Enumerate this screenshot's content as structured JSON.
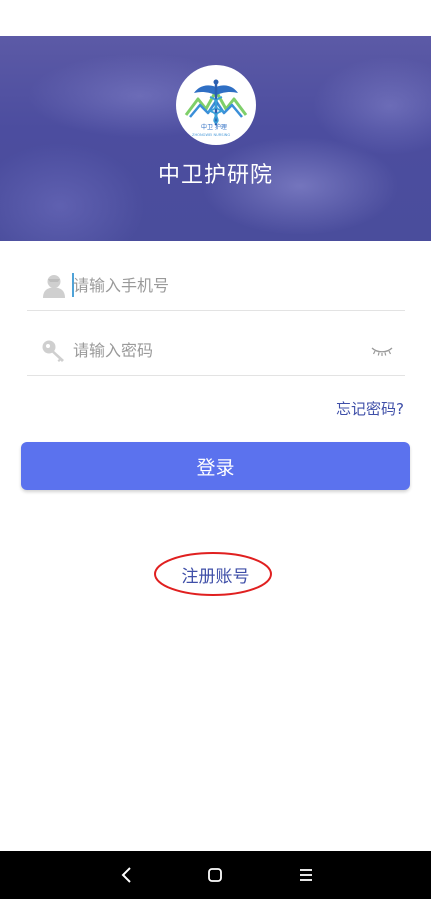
{
  "app": {
    "title": "中卫护研院",
    "logo_text_cn": "中卫 护理",
    "logo_text_en": "ZHONGWEI NURSING"
  },
  "login": {
    "phone_placeholder": "请输入手机号",
    "password_placeholder": "请输入密码",
    "forgot_label": "忘记密码?",
    "login_label": "登录",
    "register_label": "注册账号"
  },
  "icons": {
    "phone_field": "user-icon",
    "password_field": "key-icon",
    "password_toggle": "eye-closed-icon",
    "nav": [
      "back-icon",
      "home-icon",
      "menu-icon"
    ]
  },
  "colors": {
    "banner": "#4c4d9f",
    "accent_button": "#5b72ee",
    "link": "#3f4fa8",
    "annotation": "#e02020",
    "nav_bar": "#000000"
  }
}
